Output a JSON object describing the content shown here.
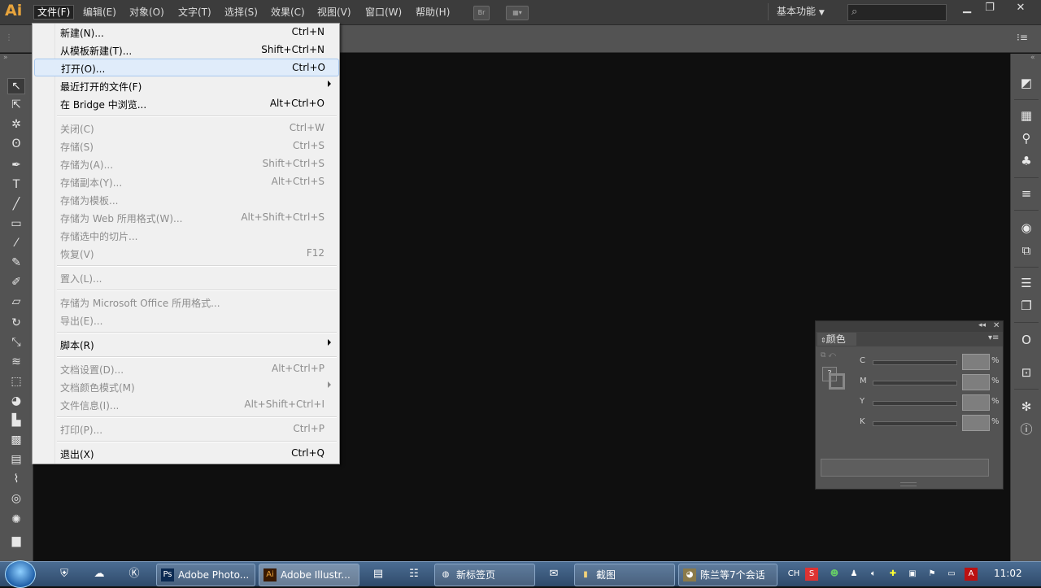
{
  "app": {
    "logo": "Ai"
  },
  "menubar": {
    "items": [
      "文件(F)",
      "编辑(E)",
      "对象(O)",
      "文字(T)",
      "选择(S)",
      "效果(C)",
      "视图(V)",
      "窗口(W)",
      "帮助(H)"
    ],
    "bridge_icon": "Br",
    "workspace": "基本功能",
    "search_placeholder": ""
  },
  "file_menu": {
    "items": [
      {
        "label": "新建(N)...",
        "shortcut": "Ctrl+N",
        "enabled": true
      },
      {
        "label": "从模板新建(T)...",
        "shortcut": "Shift+Ctrl+N",
        "enabled": true
      },
      {
        "label": "打开(O)...",
        "shortcut": "Ctrl+O",
        "enabled": true,
        "highlighted": true
      },
      {
        "label": "最近打开的文件(F)",
        "shortcut": "",
        "enabled": true,
        "submenu": true
      },
      {
        "label": "在 Bridge 中浏览...",
        "shortcut": "Alt+Ctrl+O",
        "enabled": true
      },
      {
        "label": "关闭(C)",
        "shortcut": "Ctrl+W",
        "enabled": false
      },
      {
        "label": "存储(S)",
        "shortcut": "Ctrl+S",
        "enabled": false
      },
      {
        "label": "存储为(A)...",
        "shortcut": "Shift+Ctrl+S",
        "enabled": false
      },
      {
        "label": "存储副本(Y)...",
        "shortcut": "Alt+Ctrl+S",
        "enabled": false
      },
      {
        "label": "存储为模板...",
        "shortcut": "",
        "enabled": false
      },
      {
        "label": "存储为 Web 所用格式(W)...",
        "shortcut": "Alt+Shift+Ctrl+S",
        "enabled": false
      },
      {
        "label": "存储选中的切片...",
        "shortcut": "",
        "enabled": false
      },
      {
        "label": "恢复(V)",
        "shortcut": "F12",
        "enabled": false
      },
      {
        "label": "置入(L)...",
        "shortcut": "",
        "enabled": false
      },
      {
        "label": "存储为 Microsoft Office 所用格式...",
        "shortcut": "",
        "enabled": false
      },
      {
        "label": "导出(E)...",
        "shortcut": "",
        "enabled": false
      },
      {
        "label": "脚本(R)",
        "shortcut": "",
        "enabled": true,
        "submenu": true
      },
      {
        "label": "文档设置(D)...",
        "shortcut": "Alt+Ctrl+P",
        "enabled": false
      },
      {
        "label": "文档颜色模式(M)",
        "shortcut": "",
        "enabled": false,
        "submenu": true
      },
      {
        "label": "文件信息(I)...",
        "shortcut": "Alt+Shift+Ctrl+I",
        "enabled": false
      },
      {
        "label": "打印(P)...",
        "shortcut": "Ctrl+P",
        "enabled": false
      },
      {
        "label": "退出(X)",
        "shortcut": "Ctrl+Q",
        "enabled": true
      }
    ]
  },
  "color_panel": {
    "title": "颜色",
    "help_mark": "?",
    "channels": [
      {
        "label": "C",
        "unit": "%"
      },
      {
        "label": "M",
        "unit": "%"
      },
      {
        "label": "Y",
        "unit": "%"
      },
      {
        "label": "K",
        "unit": "%"
      }
    ]
  },
  "taskbar": {
    "buttons": [
      {
        "label": "Adobe Photo...",
        "icon": "Ps"
      },
      {
        "label": "Adobe Illustr...",
        "icon": "Ai"
      },
      {
        "label": "新标签页",
        "icon": "browser-icon"
      },
      {
        "label": "截图",
        "icon": "folder-icon"
      },
      {
        "label": "陈兰等7个会话",
        "icon": "chat-icon"
      }
    ],
    "tray": {
      "lang": "CH",
      "time": "11:02"
    }
  },
  "colors": {
    "menubar_bg": "#3c3c3c",
    "panel_bg": "#535353",
    "canvas_bg": "#0f0f0f",
    "menu_bg": "#f0f0f0",
    "menu_highlight": "#e0ecfa",
    "ai_orange": "#e8a43c"
  }
}
